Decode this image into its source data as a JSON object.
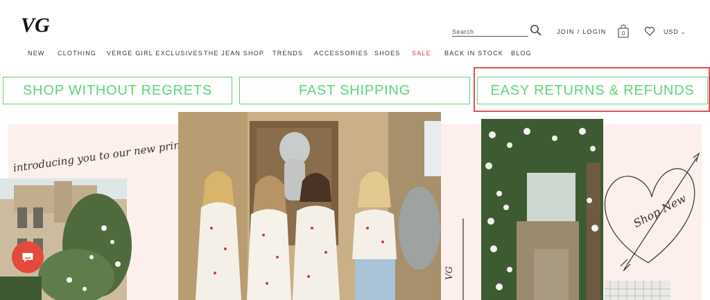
{
  "header": {
    "logo_text": "VG",
    "search": {
      "placeholder": "Search",
      "value": ""
    },
    "join_login": "JOIN / LOGIN",
    "bag_count": "0",
    "currency": "USD"
  },
  "nav": {
    "items": [
      {
        "label": "NEW"
      },
      {
        "label": "CLOTHING"
      },
      {
        "label": "VERGE GIRL EXCLUSIVES"
      },
      {
        "label": "THE JEAN SHOP"
      },
      {
        "label": "TRENDS"
      },
      {
        "label": "ACCESSORIES"
      },
      {
        "label": "SHOES"
      },
      {
        "label": "SALE"
      },
      {
        "label": "BACK IN STOCK"
      },
      {
        "label": "BLOG"
      }
    ]
  },
  "banners": [
    {
      "label": "SHOP WITHOUT REGRETS"
    },
    {
      "label": "FAST SHIPPING"
    },
    {
      "label": "EASY RETURNS & REFUNDS"
    }
  ],
  "hero": {
    "handwriting_left": "introducing you to our new print!",
    "handwriting_right": "Shop New",
    "vertical_script": "VG"
  },
  "colors": {
    "accent_green": "#5fd37a",
    "sale_red": "#e23535",
    "highlight_red": "#e0504b",
    "chat_red": "#e34a3d",
    "blush": "#fcefec"
  },
  "icons": [
    "search-icon",
    "shopping-bag-icon",
    "heart-icon",
    "chevron-down-icon",
    "chat-icon"
  ]
}
